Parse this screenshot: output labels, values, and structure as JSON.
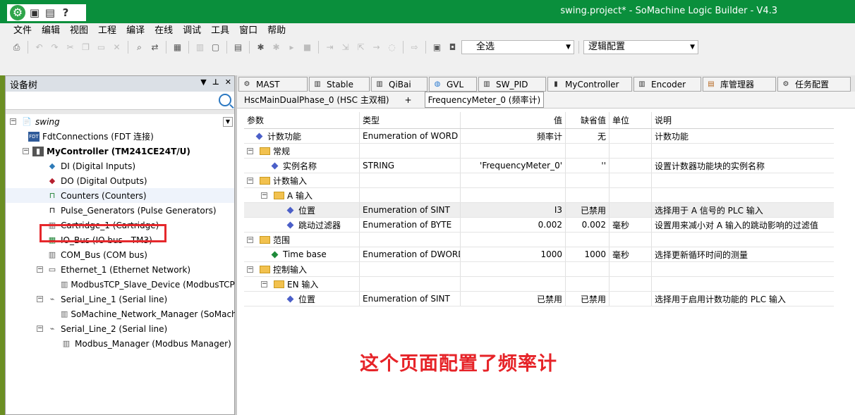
{
  "window": {
    "title": "swing.project* - SoMachine Logic Builder - V4.3",
    "quick_access": [
      "save-icon",
      "save-all-icon",
      "help-icon"
    ]
  },
  "menu": [
    "文件",
    "编辑",
    "视图",
    "工程",
    "编译",
    "在线",
    "调试",
    "工具",
    "窗口",
    "帮助"
  ],
  "toolbar": {
    "combo_select_all": "全选",
    "combo_logic_config": "逻辑配置"
  },
  "device_tree": {
    "title": "设备树",
    "nodes": [
      {
        "label": "swing"
      },
      {
        "label": "FdtConnections (FDT 连接)"
      },
      {
        "label": "MyController (TM241CE24T/U)"
      },
      {
        "label": "DI (Digital Inputs)"
      },
      {
        "label": "DO (Digital Outputs)"
      },
      {
        "label": "Counters (Counters)"
      },
      {
        "label": "Pulse_Generators (Pulse Generators)"
      },
      {
        "label": "Cartridge_1 (Cartridge)"
      },
      {
        "label": "IO_Bus (IO bus - TM3)"
      },
      {
        "label": "COM_Bus (COM bus)"
      },
      {
        "label": "Ethernet_1 (Ethernet Network)"
      },
      {
        "label": "ModbusTCP_Slave_Device (ModbusTCP Slave"
      },
      {
        "label": "Serial_Line_1 (Serial line)"
      },
      {
        "label": "SoMachine_Network_Manager (SoMachine-Ne"
      },
      {
        "label": "Serial_Line_2 (Serial line)"
      },
      {
        "label": "Modbus_Manager (Modbus Manager)"
      }
    ]
  },
  "editor_tabs": [
    "MAST",
    "Stable",
    "QiBai",
    "GVL",
    "SW_PID",
    "MyController",
    "Encoder",
    "库管理器",
    "任务配置"
  ],
  "sub_tabs": {
    "first": "HscMainDualPhase_0 (HSC 主双相)",
    "add": "+",
    "active": "FrequencyMeter_0 (频率计)"
  },
  "grid": {
    "headers": [
      "参数",
      "类型",
      "值",
      "缺省值",
      "单位",
      "说明"
    ],
    "rows": [
      {
        "param": "计数功能",
        "type": "Enumeration of WORD",
        "value": "频率计",
        "default": "无",
        "unit": "",
        "desc": "计数功能"
      },
      {
        "param": "常规",
        "type": "",
        "value": "",
        "default": "",
        "unit": "",
        "desc": ""
      },
      {
        "param": "实例名称",
        "type": "STRING",
        "value": "'FrequencyMeter_0'",
        "default": "''",
        "unit": "",
        "desc": "设置计数器功能块的实例名称"
      },
      {
        "param": "计数输入",
        "type": "",
        "value": "",
        "default": "",
        "unit": "",
        "desc": ""
      },
      {
        "param": "A 输入",
        "type": "",
        "value": "",
        "default": "",
        "unit": "",
        "desc": ""
      },
      {
        "param": "位置",
        "type": "Enumeration of SINT",
        "value": "I3",
        "default": "已禁用",
        "unit": "",
        "desc": "选择用于 A 信号的 PLC 输入"
      },
      {
        "param": "跳动过滤器",
        "type": "Enumeration of BYTE",
        "value": "0.002",
        "default": "0.002",
        "unit": "毫秒",
        "desc": "设置用来减小对 A 输入的跳动影响的过滤值"
      },
      {
        "param": "范围",
        "type": "",
        "value": "",
        "default": "",
        "unit": "",
        "desc": ""
      },
      {
        "param": "Time base",
        "type": "Enumeration of DWORD",
        "value": "1000",
        "default": "1000",
        "unit": "毫秒",
        "desc": "选择更新循环时间的测量"
      },
      {
        "param": "控制输入",
        "type": "",
        "value": "",
        "default": "",
        "unit": "",
        "desc": ""
      },
      {
        "param": "EN 输入",
        "type": "",
        "value": "",
        "default": "",
        "unit": "",
        "desc": ""
      },
      {
        "param": "位置",
        "type": "Enumeration of SINT",
        "value": "已禁用",
        "default": "已禁用",
        "unit": "",
        "desc": "选择用于启用计数功能的 PLC 输入"
      }
    ]
  },
  "annotation": "这个页面配置了频率计"
}
